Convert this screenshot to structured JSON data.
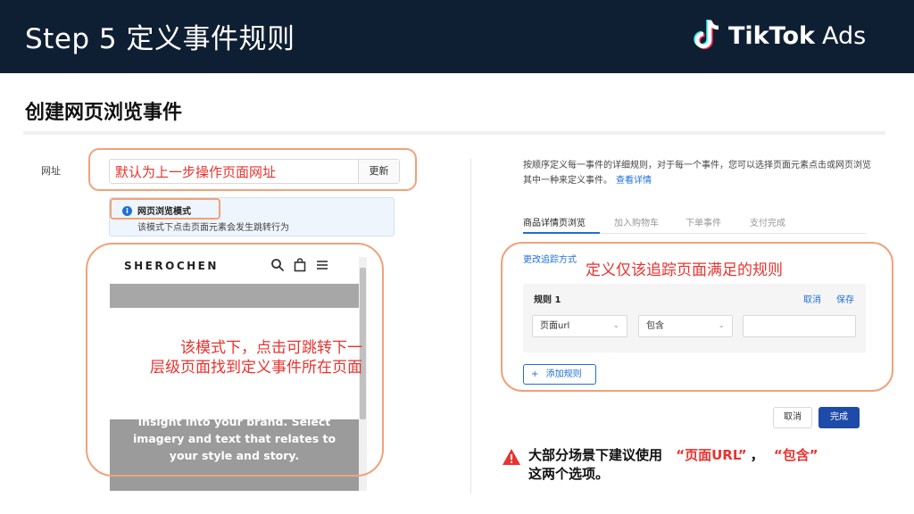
{
  "header": {
    "title": "Step 5 定义事件规则",
    "brand_name": "TikTok",
    "brand_suffix": "Ads"
  },
  "section_title": "创建网页浏览事件",
  "left_panel": {
    "url_label": "网址",
    "url_value": "默认为上一步操作页面网址",
    "update_button": "更新",
    "mode_title": "网页浏览模式",
    "mode_desc": "该模式下点击页面元素会发生跳转行为",
    "preview": {
      "shop_name": "SHEROCHEN",
      "body_text": "insight into your brand. Select imagery and text that relates to your style and story."
    },
    "note_line1": "该模式下，点击可跳转下一",
    "note_line2": "层级页面找到定义事件所在页面"
  },
  "right_panel": {
    "description": "按顺序定义每一事件的详细规则，对于每一个事件，您可以选择页面元素点击或网页浏览其中一种来定义事件。",
    "description_link": "查看详情",
    "tabs": [
      {
        "label": "商品详情页浏览",
        "active": true
      },
      {
        "label": "加入购物车",
        "active": false
      },
      {
        "label": "下单事件",
        "active": false
      },
      {
        "label": "支付完成",
        "active": false
      }
    ],
    "tracking_link": "更改追踪方式",
    "note": "定义仅该追踪页面满足的规则",
    "rule": {
      "title": "规则 1",
      "cancel": "取消",
      "save": "保存",
      "field_select": "页面url",
      "operator_select": "包含",
      "value_input": ""
    },
    "add_rule": "添加规则",
    "cancel_button": "取消",
    "done_button": "完成"
  },
  "warning": {
    "text_a": "大部分场景下建议使用",
    "highlight_1": "“页面URL”",
    "sep": "，",
    "highlight_2": "“包含”",
    "text_b": "这两个选项。"
  },
  "colors": {
    "header_bg": "#0f1f33",
    "accent_red": "#e8332f",
    "link_blue": "#1e6fd9",
    "callout_orange": "#f0a27a",
    "primary_button": "#1e4aa8"
  }
}
